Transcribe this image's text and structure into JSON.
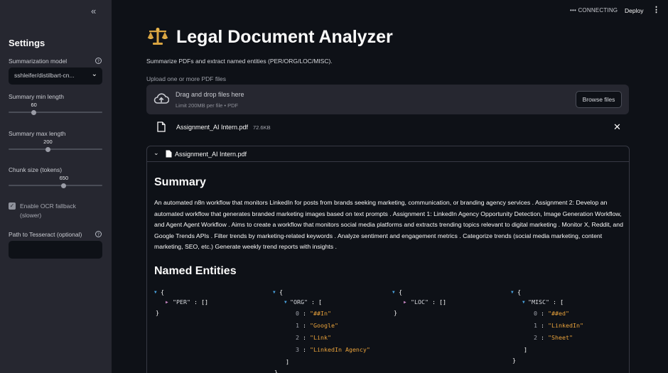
{
  "sidebar": {
    "title": "Settings",
    "collapse_icon": "«",
    "model": {
      "label": "Summarization model",
      "value": "sshleifer/distilbart-cn..."
    },
    "min_length": {
      "label": "Summary min length",
      "value": "60",
      "fraction": 0.27
    },
    "max_length": {
      "label": "Summary max length",
      "value": "200",
      "fraction": 0.42
    },
    "chunk_size": {
      "label": "Chunk size (tokens)",
      "value": "650",
      "fraction": 0.59
    },
    "ocr": {
      "label": "Enable OCR fallback (slower)",
      "checked": true
    },
    "tesseract": {
      "label": "Path to Tesseract (optional)",
      "value": ""
    }
  },
  "topbar": {
    "status": "CONNECTING",
    "deploy": "Deploy"
  },
  "main": {
    "title": "Legal Document Analyzer",
    "subtitle": "Summarize PDFs and extract named entities (PER/ORG/LOC/MISC).",
    "upload_label": "Upload one or more PDF files",
    "dropzone": {
      "main": "Drag and drop files here",
      "sub": "Limit 200MB per file • PDF",
      "browse": "Browse files"
    },
    "file": {
      "name": "Assignment_AI Intern.pdf",
      "size": "72.6KB"
    },
    "expander": {
      "title": "Assignment_AI Intern.pdf",
      "summary_heading": "Summary",
      "summary": "An automated n8n workflow that monitors LinkedIn for posts from brands seeking marketing, communication, or branding agency services . Assignment 2: Develop an automated workflow that generates branded marketing images based on text prompts . Assignment 1: LinkedIn Agency Opportunity Detection, Image Generation Workflow, and Agent Agent Workflow . Aims to create a workflow that monitors social media platforms and extracts trending topics relevant to digital marketing . Monitor X, Reddit, and Google Trends APIs . Filter trends by marketing-related keywords . Analyze sentiment and engagement metrics . Categorize trends (social media marketing, content marketing, SEO, etc.) Generate weekly trend reports with insights .",
      "entities_heading": "Named Entities",
      "entities": {
        "per": {
          "key": "\"PER\"",
          "empty": "[]"
        },
        "org": {
          "key": "\"ORG\"",
          "items": [
            "\"##In\"",
            "\"Google\"",
            "\"Link\"",
            "\"LinkedIn Agency\""
          ]
        },
        "loc": {
          "key": "\"LOC\"",
          "empty": "[]"
        },
        "misc": {
          "key": "\"MISC\"",
          "items": [
            "\"##ed\"",
            "\"LinkedIn\"",
            "\"Sheet\""
          ]
        }
      }
    }
  }
}
